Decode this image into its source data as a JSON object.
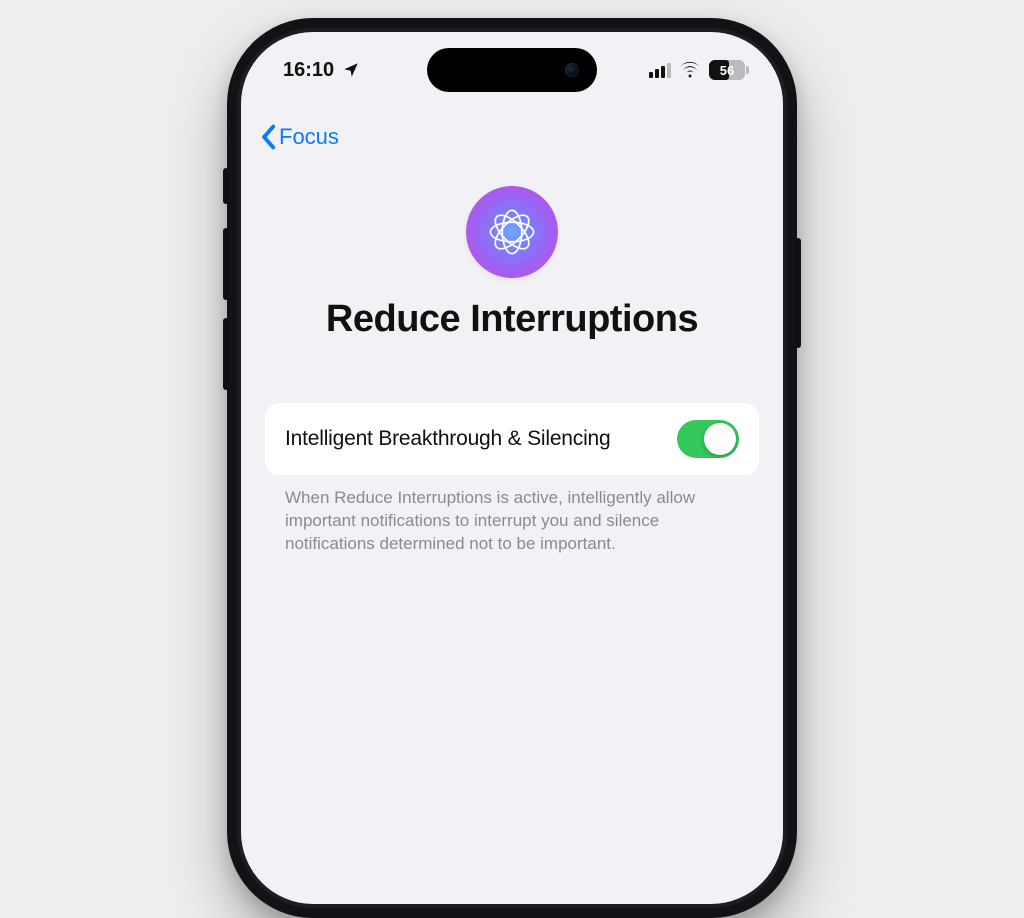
{
  "statusbar": {
    "time": "16:10",
    "battery_pct": "56"
  },
  "navbar": {
    "back_label": "Focus"
  },
  "page": {
    "title": "Reduce Interruptions"
  },
  "setting": {
    "label": "Intelligent Breakthrough & Silencing",
    "enabled": true,
    "description": "When Reduce Interruptions is active, intelligently allow important notifications to interrupt you and silence notifications determined not to be important."
  },
  "colors": {
    "ios_blue": "#0a7aff",
    "toggle_green": "#34c759",
    "bg": "#f2f2f6"
  }
}
